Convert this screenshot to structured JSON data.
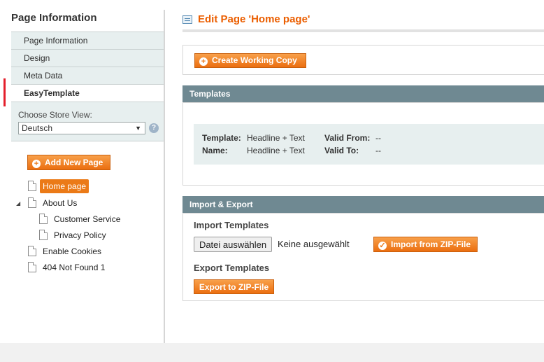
{
  "sidebar": {
    "title": "Page Information",
    "tabs": [
      {
        "label": "Page Information"
      },
      {
        "label": "Design"
      },
      {
        "label": "Meta Data"
      },
      {
        "label": "EasyTemplate"
      }
    ],
    "store_view": {
      "label": "Choose Store View:",
      "selected": "Deutsch",
      "help_icon": "?"
    },
    "add_page_label": "Add New Page",
    "tree": [
      {
        "label": "Home page"
      },
      {
        "label": "About Us"
      },
      {
        "label": "Customer Service"
      },
      {
        "label": "Privacy Policy"
      },
      {
        "label": "Enable Cookies"
      },
      {
        "label": "404 Not Found 1"
      }
    ]
  },
  "main": {
    "title": "Edit Page 'Home page'",
    "create_copy_label": "Create Working Copy",
    "templates": {
      "heading": "Templates",
      "template_label": "Template:",
      "template_value": "Headline + Text",
      "name_label": "Name:",
      "name_value": "Headline + Text",
      "valid_from_label": "Valid From:",
      "valid_from_value": "--",
      "valid_to_label": "Valid To:",
      "valid_to_value": "--"
    },
    "import_export": {
      "heading": "Import & Export",
      "import_heading": "Import Templates",
      "file_button": "Datei auswählen",
      "file_status": "Keine ausgewählt",
      "import_button": "Import from ZIP-File",
      "export_heading": "Export Templates",
      "export_button": "Export to ZIP-File"
    }
  },
  "colors": {
    "accent": "#eb5e00",
    "button": "#ec7a1c",
    "section_header": "#6f8992",
    "tab_background": "#e7efef",
    "active_marker": "#e41f2b"
  }
}
